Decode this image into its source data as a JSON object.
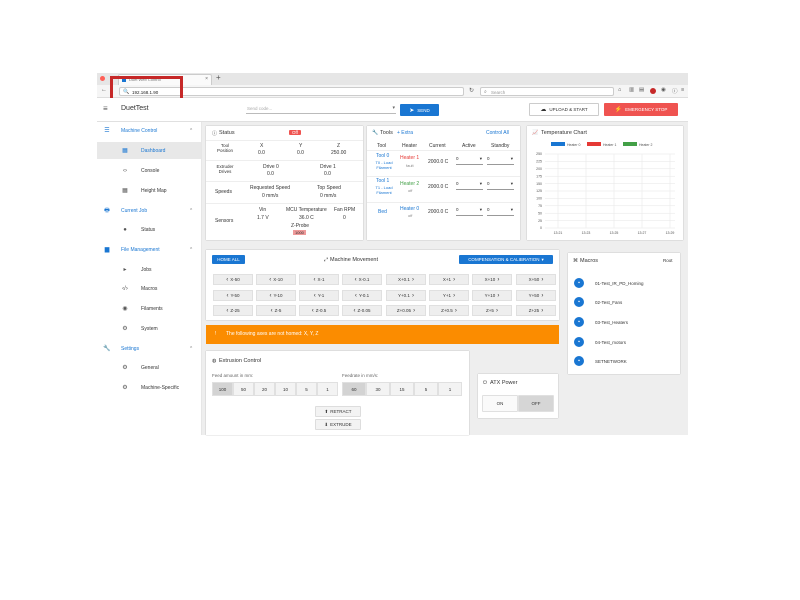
{
  "browser": {
    "tab_title": "Duet Web Control",
    "url": "192.168.1.90",
    "search_placeholder": "Search"
  },
  "topbar": {
    "title": "DuetTest",
    "gcode_placeholder": "Send code...",
    "send_label": "SEND",
    "upload_label": "UPLOAD & START",
    "emergency_label": "EMERGENCY STOP"
  },
  "sidebar": {
    "sections": [
      {
        "label": "Machine Control",
        "items": [
          "Dashboard",
          "Console",
          "Height Map"
        ]
      },
      {
        "label": "Current Job",
        "items": [
          "Status"
        ]
      },
      {
        "label": "File Management",
        "items": [
          "Jobs",
          "Macros",
          "Filaments",
          "System"
        ]
      },
      {
        "label": "Settings",
        "items": [
          "General",
          "Machine-Specific"
        ]
      }
    ]
  },
  "status": {
    "title": "Status",
    "badge": "Off",
    "tool_position_label": "Tool Position",
    "axes": [
      {
        "name": "X",
        "value": "0.0"
      },
      {
        "name": "Y",
        "value": "0.0"
      },
      {
        "name": "Z",
        "value": "250.00"
      }
    ],
    "extruder_label": "Extruder Drives",
    "drives": [
      {
        "name": "Drive 0",
        "value": "0.0"
      },
      {
        "name": "Drive 1",
        "value": "0.0"
      }
    ],
    "speeds_label": "Speeds",
    "requested_speed_label": "Requested Speed",
    "requested_speed": "0 mm/s",
    "top_speed_label": "Top Speed",
    "top_speed": "0 mm/s",
    "sensors_label": "Sensors",
    "vin_label": "Vin",
    "vin": "1.7 V",
    "mcu_label": "MCU Temperature",
    "mcu": "36.0 C",
    "fan_label": "Fan RPM",
    "fan": "0",
    "zprobe_label": "Z-Probe",
    "zprobe": "1000"
  },
  "tools": {
    "title": "Tools",
    "extra_label": "+ Extra",
    "control_all": "Control All",
    "headers": [
      "Tool",
      "Heater",
      "Current",
      "Active",
      "Standby"
    ],
    "rows": [
      {
        "tool": "Tool 0",
        "sub": "T0 - Load Filament",
        "heater": "Heater 1",
        "state": "fault",
        "current": "2000.0 C",
        "active": "0",
        "standby": "0"
      },
      {
        "tool": "Tool 1",
        "sub": "T1 - Load Filament",
        "heater": "Heater 2",
        "state": "off",
        "current": "2000.0 C",
        "active": "0",
        "standby": "0"
      },
      {
        "tool": "Bed",
        "sub": "",
        "heater": "Heater 0",
        "state": "off",
        "current": "2000.0 C",
        "active": "0",
        "standby": "0"
      }
    ]
  },
  "temp_chart": {
    "title": "Temperature Chart",
    "legend": [
      "Heater 0",
      "Heater 1",
      "Heater 2"
    ],
    "y_ticks": [
      "250",
      "225",
      "200",
      "175",
      "150",
      "125",
      "100",
      "75",
      "50",
      "25",
      "0"
    ],
    "x_ticks": [
      "13:21",
      "13:23",
      "13:25",
      "13:27",
      "13:29"
    ],
    "colors": [
      "#1976d2",
      "#e53935",
      "#43a047"
    ]
  },
  "movement": {
    "home_all": "HOME ALL",
    "title": "Machine Movement",
    "compensation": "COMPENSATION & CALIBRATION",
    "rows": [
      [
        "X-50",
        "X-10",
        "X-1",
        "X-0.1",
        "X+0.1",
        "X+1",
        "X+10",
        "X+50"
      ],
      [
        "Y-50",
        "Y-10",
        "Y-1",
        "Y-0.1",
        "Y+0.1",
        "Y+1",
        "Y+10",
        "Y+50"
      ],
      [
        "Z-25",
        "Z-5",
        "Z-0.5",
        "Z-0.05",
        "Z+0.05",
        "Z+0.5",
        "Z+5",
        "Z+25"
      ]
    ],
    "warning": "The following axes are not homed: X, Y, Z"
  },
  "macros": {
    "title": "Macros",
    "root": "Root",
    "items": [
      "01-Test_IR_PD_Homing",
      "02-Test_Fans",
      "03-Test_Heaters",
      "04-Test_motors",
      "SETNETWORK"
    ]
  },
  "extrusion": {
    "title": "Extrusion Control",
    "feed_label": "Feed amount in mm:",
    "feed_values": [
      "100",
      "50",
      "20",
      "10",
      "5",
      "1"
    ],
    "rate_label": "Feedrate in mm/s:",
    "rate_values": [
      "60",
      "30",
      "15",
      "5",
      "1"
    ],
    "retract": "RETRACT",
    "extrude": "EXTRUDE"
  },
  "atx": {
    "title": "ATX Power",
    "on": "ON",
    "off": "OFF"
  },
  "colors": {
    "accent": "#1976d2",
    "danger": "#ef5350",
    "warning": "#fb8c00",
    "highlight": "#c62828"
  }
}
